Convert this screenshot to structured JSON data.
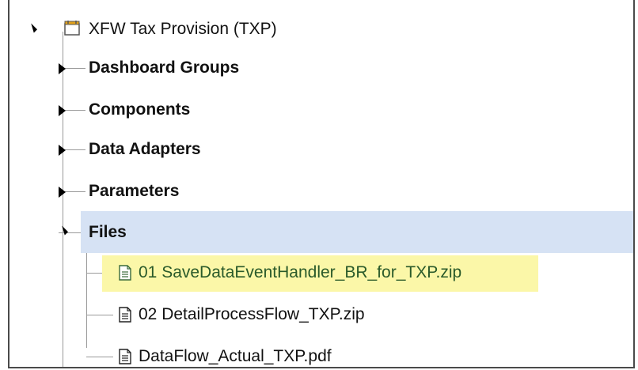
{
  "tree": {
    "root": {
      "label": "XFW Tax Provision (TXP)",
      "icon": "folder-icon",
      "expanded": true
    },
    "groups": [
      {
        "label": "Dashboard Groups",
        "expanded": false
      },
      {
        "label": "Components",
        "expanded": false
      },
      {
        "label": "Data Adapters",
        "expanded": false
      },
      {
        "label": "Parameters",
        "expanded": false
      },
      {
        "label": "Files",
        "expanded": true,
        "selected": true
      }
    ],
    "files": [
      {
        "label": "01 SaveDataEventHandler_BR_for_TXP.zip",
        "icon": "document-icon",
        "highlighted": true
      },
      {
        "label": "02 DetailProcessFlow_TXP.zip",
        "icon": "document-icon"
      },
      {
        "label": "DataFlow_Actual_TXP.pdf",
        "icon": "document-icon"
      }
    ]
  },
  "colors": {
    "selection": "#d6e2f4",
    "highlight": "#fbf7a8",
    "folder_accent": "#e3a21a",
    "highlight_text": "#2a5a2a"
  }
}
